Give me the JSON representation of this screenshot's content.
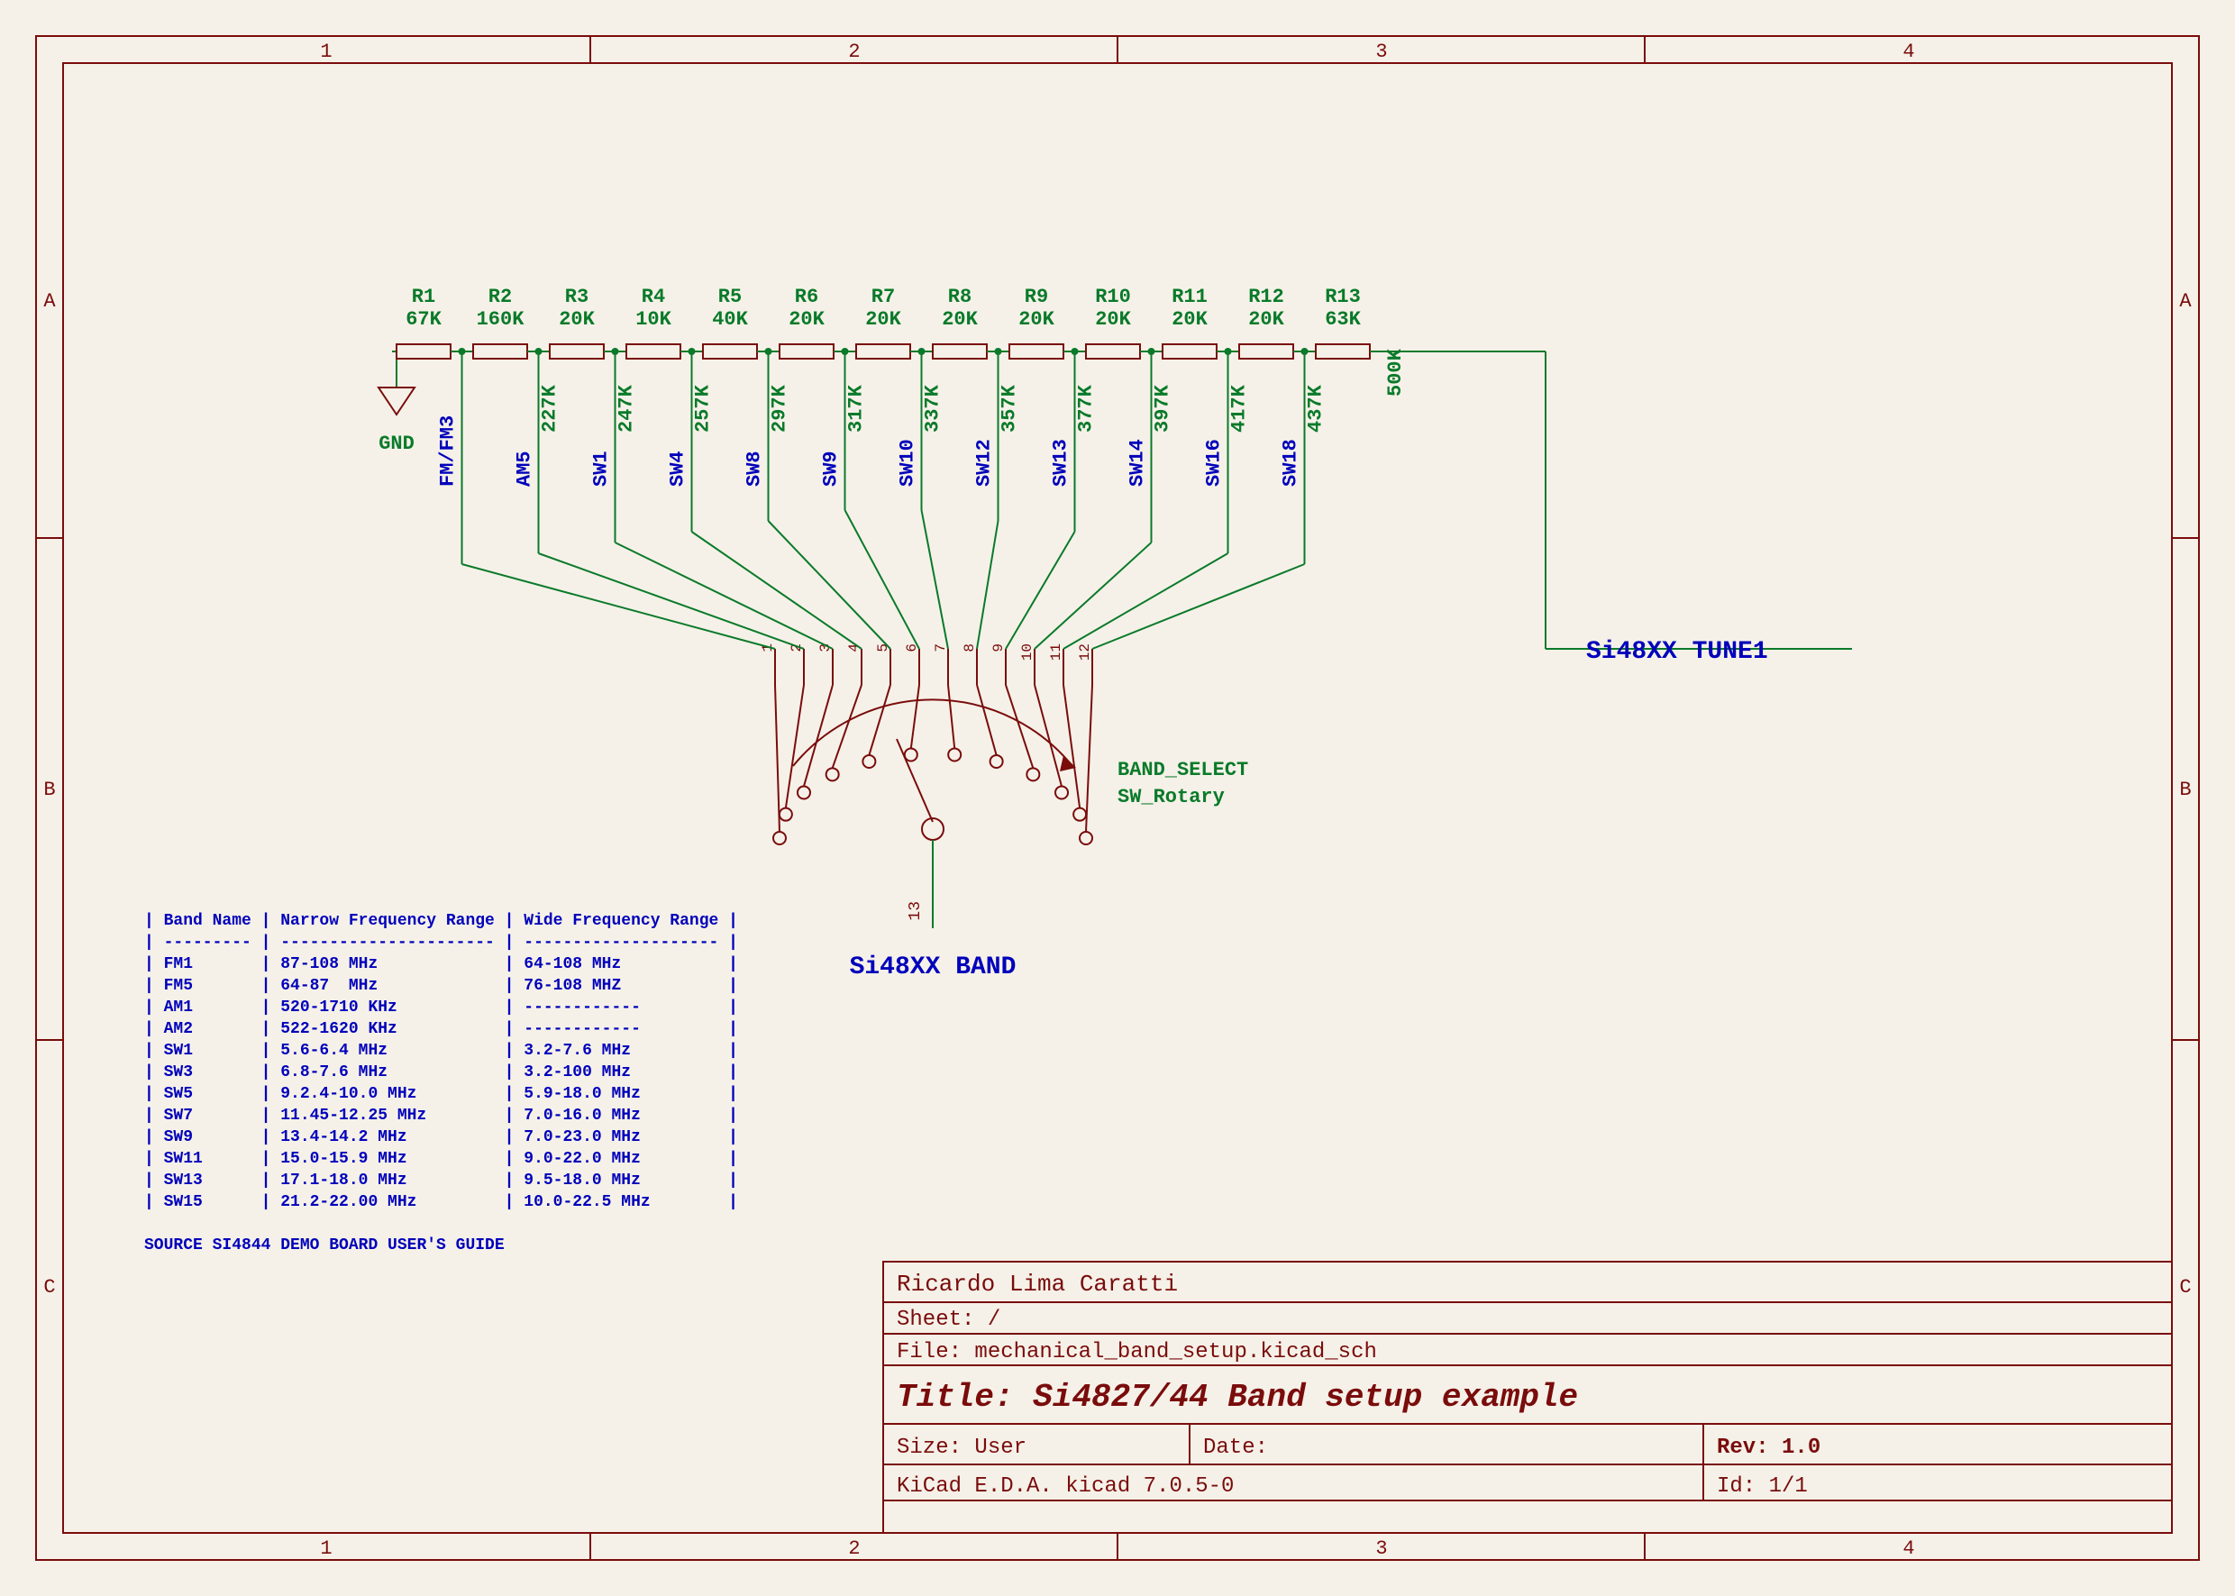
{
  "border": {
    "cols": [
      "1",
      "2",
      "3",
      "4"
    ],
    "rows": [
      "A",
      "B",
      "C"
    ]
  },
  "gnd_label": "GND",
  "tune_label": "Si48XX TUNE1",
  "band_label": "Si48XX BAND",
  "switch_name": "BAND_SELECT",
  "switch_type": "SW_Rotary",
  "switch_pin_common": "13",
  "resistors": [
    {
      "ref": "R1",
      "val": "67K"
    },
    {
      "ref": "R2",
      "val": "160K"
    },
    {
      "ref": "R3",
      "val": "20K"
    },
    {
      "ref": "R4",
      "val": "10K"
    },
    {
      "ref": "R5",
      "val": "40K"
    },
    {
      "ref": "R6",
      "val": "20K"
    },
    {
      "ref": "R7",
      "val": "20K"
    },
    {
      "ref": "R8",
      "val": "20K"
    },
    {
      "ref": "R9",
      "val": "20K"
    },
    {
      "ref": "R10",
      "val": "20K"
    },
    {
      "ref": "R11",
      "val": "20K"
    },
    {
      "ref": "R12",
      "val": "20K"
    },
    {
      "ref": "R13",
      "val": "63K"
    }
  ],
  "taps": [
    {
      "band": "FM/FM3",
      "res": ""
    },
    {
      "band": "AM5",
      "res": "227K"
    },
    {
      "band": "SW1",
      "res": "247K"
    },
    {
      "band": "SW4",
      "res": "257K"
    },
    {
      "band": "SW8",
      "res": "297K"
    },
    {
      "band": "SW9",
      "res": "317K"
    },
    {
      "band": "SW10",
      "res": "337K"
    },
    {
      "band": "SW12",
      "res": "357K"
    },
    {
      "band": "SW13",
      "res": "377K"
    },
    {
      "band": "SW14",
      "res": "397K"
    },
    {
      "band": "SW16",
      "res": "417K"
    },
    {
      "band": "SW18",
      "res": "437K"
    }
  ],
  "tune_res": "500K",
  "switch_pins": [
    "1",
    "2",
    "3",
    "4",
    "5",
    "6",
    "7",
    "8",
    "9",
    "10",
    "11",
    "12"
  ],
  "table_header": "| Band Name | Narrow Frequency Range | Wide Frequency Range |",
  "table_sep": "| --------- | ---------------------- | -------------------- |",
  "table_rows": [
    "| FM1       | 87-108 MHz             | 64-108 MHz           |",
    "| FM5       | 64-87  MHz             | 76-108 MHZ           |",
    "| AM1       | 520-1710 KHz           | ------------         |",
    "| AM2       | 522-1620 KHz           | ------------         |",
    "| SW1       | 5.6-6.4 MHz            | 3.2-7.6 MHz          |",
    "| SW3       | 6.8-7.6 MHz            | 3.2-100 MHz          |",
    "| SW5       | 9.2.4-10.0 MHz         | 5.9-18.0 MHz         |",
    "| SW7       | 11.45-12.25 MHz        | 7.0-16.0 MHz         |",
    "| SW9       | 13.4-14.2 MHz          | 7.0-23.0 MHz         |",
    "| SW11      | 15.0-15.9 MHz          | 9.0-22.0 MHz         |",
    "| SW13      | 17.1-18.0 MHz          | 9.5-18.0 MHz         |",
    "| SW15      | 21.2-22.00 MHz         | 10.0-22.5 MHz        |"
  ],
  "table_source": "SOURCE SI4844 DEMO BOARD USER'S GUIDE",
  "title_block": {
    "author": "Ricardo Lima Caratti",
    "sheet": "Sheet: /",
    "file": "File: mechanical_band_setup.kicad_sch",
    "title_prefix": "Title: ",
    "title": "Si4827/44 Band setup example",
    "size": "Size: User",
    "date": "Date:",
    "rev": "Rev: 1.0",
    "tool": "KiCad E.D.A.  kicad 7.0.5-0",
    "id": "Id: 1/1"
  }
}
